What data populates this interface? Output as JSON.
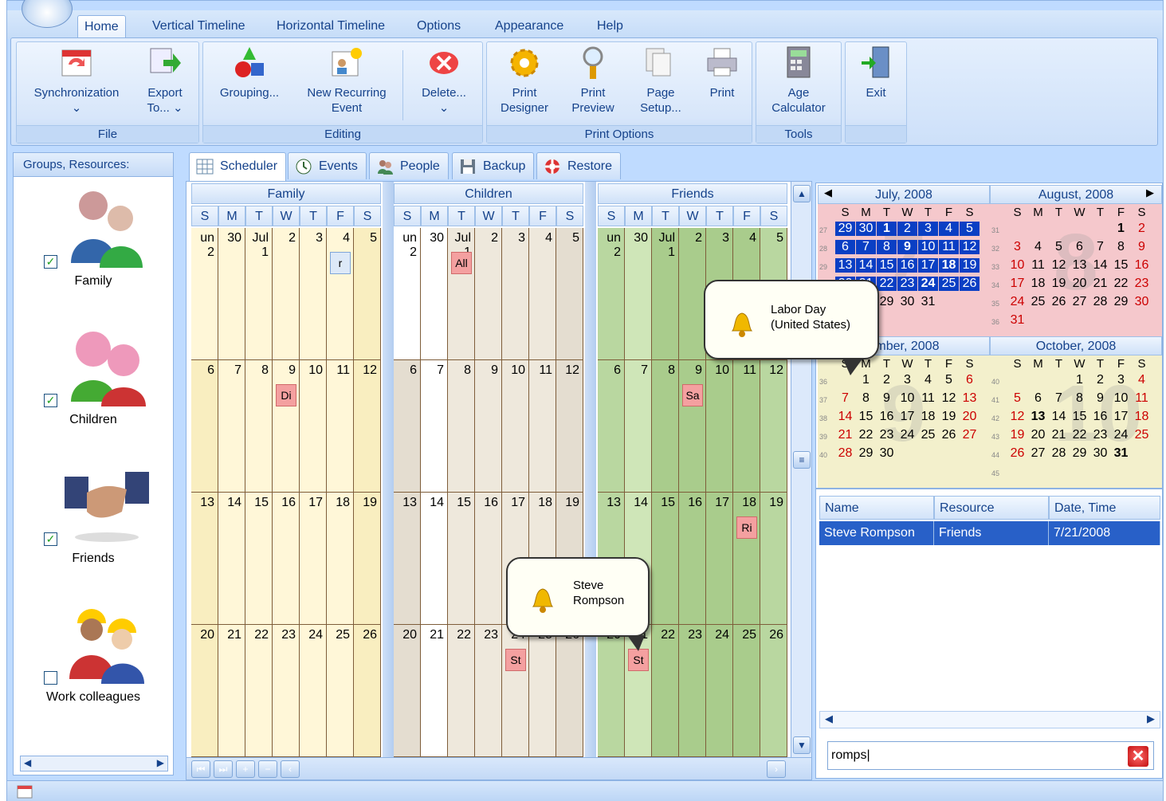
{
  "ribbon_tabs": [
    "Home",
    "Vertical Timeline",
    "Horizontal Timeline",
    "Options",
    "Appearance",
    "Help"
  ],
  "groups": {
    "file": {
      "label": "File",
      "sync": "Synchronization",
      "export1": "Export",
      "export2": "To..."
    },
    "editing": {
      "label": "Editing",
      "grouping": "Grouping...",
      "recurring1": "New Recurring",
      "recurring2": "Event",
      "delete": "Delete..."
    },
    "print": {
      "label": "Print Options",
      "designer1": "Print",
      "designer2": "Designer",
      "preview1": "Print",
      "preview2": "Preview",
      "setup1": "Page",
      "setup2": "Setup...",
      "print": "Print"
    },
    "tools": {
      "label": "Tools",
      "age1": "Age",
      "age2": "Calculator"
    },
    "exit": "Exit"
  },
  "left_pane": {
    "title": "Groups, Resources:",
    "resources": [
      {
        "name": "Family",
        "checked": true
      },
      {
        "name": "Children",
        "checked": true
      },
      {
        "name": "Friends",
        "checked": true
      },
      {
        "name": "Work colleagues",
        "checked": false
      }
    ]
  },
  "doc_tabs": [
    "Scheduler",
    "Events",
    "People",
    "Backup",
    "Restore"
  ],
  "scheduler": {
    "groups": [
      "Family",
      "Children",
      "Friends"
    ],
    "day_letters": [
      "S",
      "M",
      "T",
      "W",
      "T",
      "F",
      "S"
    ],
    "weeks": [
      [
        "un 2",
        "30",
        "Jul 1",
        "2",
        "3",
        "4",
        "5"
      ],
      [
        "6",
        "7",
        "8",
        "9",
        "10",
        "11",
        "12"
      ],
      [
        "13",
        "14",
        "15",
        "16",
        "17",
        "18",
        "19"
      ],
      [
        "20",
        "21",
        "22",
        "23",
        "24",
        "25",
        "26"
      ]
    ],
    "appointments": {
      "family_fri": "r",
      "family_wed": "Di",
      "children_tue": "All",
      "children_thu": "St",
      "friends_wed": "Sa",
      "friends_fri": "Ri",
      "friends_mon": "St"
    }
  },
  "balloons": {
    "labor1": "Labor Day",
    "labor2": "(United States)",
    "steve1": "Steve",
    "steve2": "Rompson"
  },
  "calendars": {
    "day_letters": [
      "S",
      "M",
      "T",
      "W",
      "T",
      "F",
      "S"
    ],
    "july": "July, 2008",
    "august": "August, 2008",
    "september": "ember, 2008",
    "october": "October, 2008"
  },
  "results": {
    "headers": [
      "Name",
      "Resource",
      "Date, Time"
    ],
    "row": [
      "Steve Rompson",
      "Friends",
      "7/21/2008"
    ]
  },
  "search": {
    "value": "romps"
  }
}
